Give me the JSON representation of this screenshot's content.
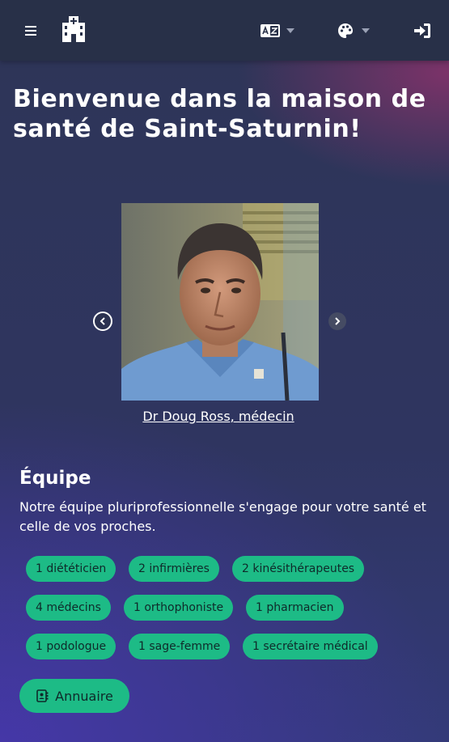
{
  "header": {
    "menu_icon": "hamburger-icon",
    "logo_icon": "clinic-building-icon",
    "language_icon": "translate-icon",
    "theme_icon": "palette-icon",
    "login_icon": "sign-in-icon"
  },
  "hero": {
    "title": "Bienvenue dans la maison de santé de Saint-Saturnin!"
  },
  "carousel": {
    "current_caption": "Dr Doug Ross, médecin"
  },
  "team": {
    "heading": "Équipe",
    "description": "Notre équipe pluriprofessionnelle s'engage pour votre santé et celle de vos proches.",
    "chips": [
      "1 diététicien",
      "2 infirmières",
      "2 kinésithérapeutes",
      "4 médecins",
      "1 orthophoniste",
      "1 pharmacien",
      "1 podologue",
      "1 sage-femme",
      "1 secrétaire médical"
    ],
    "directory_button": "Annuaire"
  },
  "colors": {
    "navbar": "#283048",
    "accent_green": "#1dbb86",
    "text": "#ffffff"
  }
}
